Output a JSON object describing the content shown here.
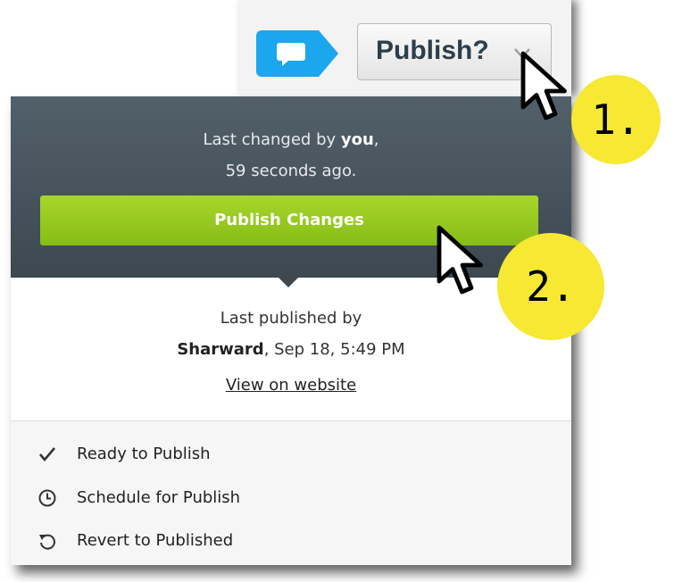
{
  "toolbar": {
    "publish_label": "Publish?",
    "comment_icon": "speech-bubble-icon",
    "chevron_icon": "chevron-down-icon",
    "comment_color": "#1ca6ee"
  },
  "panel": {
    "changed_prefix": "Last changed by ",
    "changed_user": "you",
    "changed_suffix": ",",
    "changed_time": "59 seconds ago.",
    "publish_changes_label": "Publish Changes",
    "published_line1": "Last published by",
    "published_user": "Sharward",
    "published_when": ", Sep 18, 5:49 PM",
    "view_link": "View on website",
    "menu": [
      {
        "label": "Ready to Publish",
        "icon": "checkmark-icon"
      },
      {
        "label": "Schedule for Publish",
        "icon": "clock-icon"
      },
      {
        "label": "Revert to Published",
        "icon": "revert-icon"
      }
    ]
  },
  "annotations": {
    "step1": "1.",
    "step2": "2.",
    "marker_color": "#f6e833"
  },
  "colors": {
    "dark_panel": "#46525b",
    "green_button": "#97c91f"
  }
}
